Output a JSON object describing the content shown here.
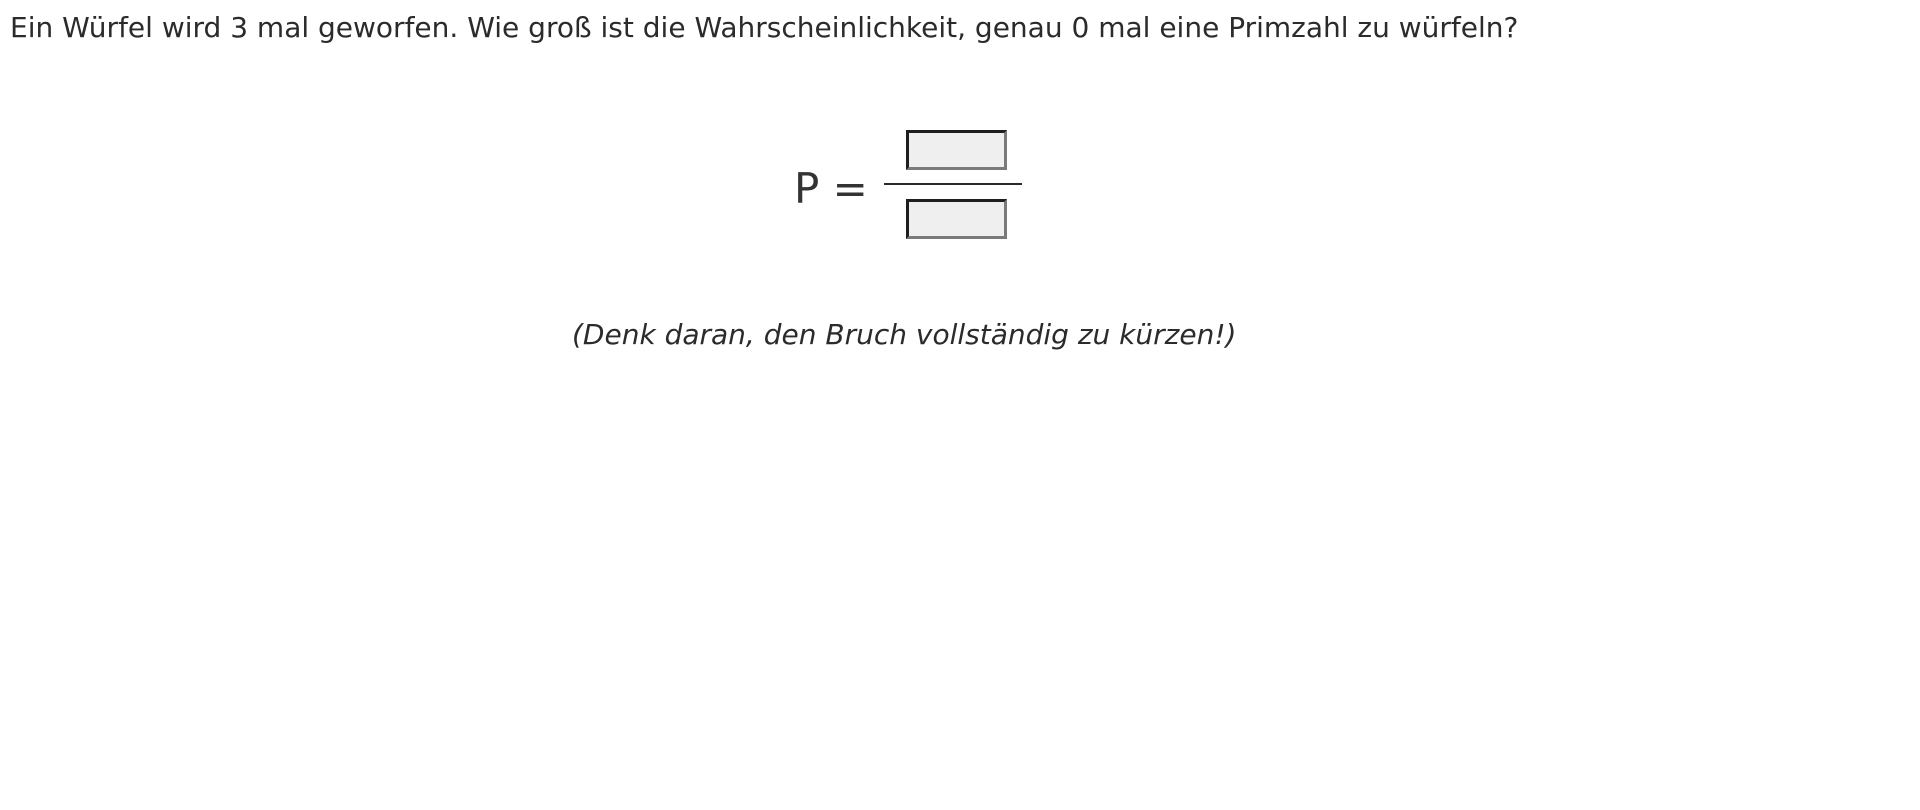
{
  "question": {
    "text": "Ein Würfel wird 3 mal geworfen. Wie groß ist die Wahrscheinlichkeit, genau 0 mal eine Primzahl zu würfeln?"
  },
  "equation": {
    "lhs": "P =",
    "numerator": {
      "value": "",
      "placeholder": ""
    },
    "denominator": {
      "value": "",
      "placeholder": ""
    }
  },
  "hint": {
    "text": "(Denk daran, den Bruch vollständig zu kürzen!)"
  }
}
